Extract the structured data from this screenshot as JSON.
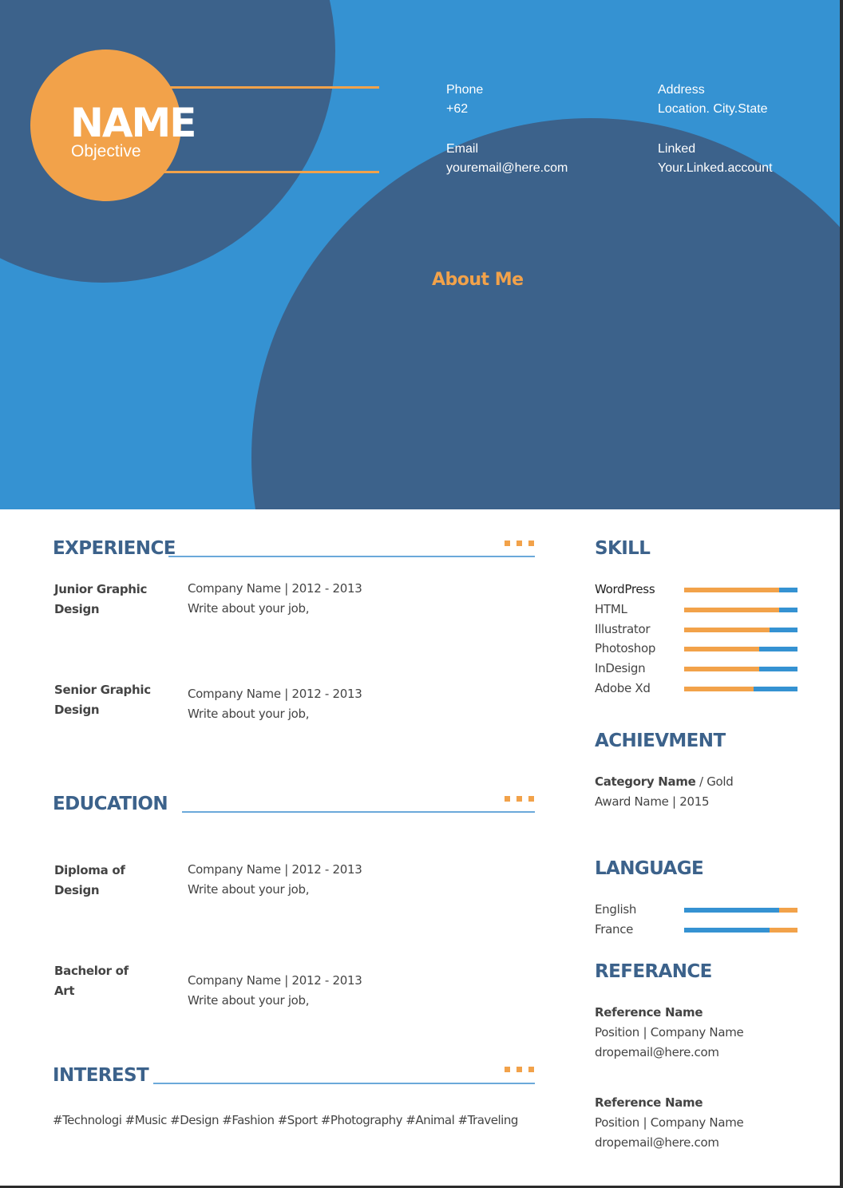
{
  "header": {
    "name": "NAME",
    "objective": "Objective",
    "contacts": [
      {
        "label": "Phone",
        "value": "+62"
      },
      {
        "label": "Address",
        "value": "Location. City.State"
      },
      {
        "label": "Email",
        "value": "youremail@here.com"
      },
      {
        "label": "Linked",
        "value": "Your.Linked.account"
      }
    ],
    "about_title": "About Me"
  },
  "colors": {
    "light_blue": "#3592d2",
    "dark_blue": "#3c628b",
    "orange": "#f2a24a",
    "text": "#444444"
  },
  "experience": {
    "title": "EXPERIENCE",
    "entries": [
      {
        "title": "Junior Graphic Design",
        "company": "Company Name | 2012 - 2013",
        "desc": "Write about your job,"
      },
      {
        "title": "Senior Graphic Design",
        "company": "Company Name | 2012 - 2013",
        "desc": "Write about your job,"
      }
    ]
  },
  "education": {
    "title": "EDUCATION",
    "entries": [
      {
        "title": "Diploma of Design",
        "company": "Company Name | 2012 - 2013",
        "desc": "Write about your job,"
      },
      {
        "title": "Bachelor of Art",
        "company": "Company Name | 2012 - 2013",
        "desc": "Write about your job,"
      }
    ]
  },
  "interest": {
    "title": "INTEREST",
    "text": "#Technologi #Music #Design #Fashion #Sport #Photography #Animal #Traveling"
  },
  "skill": {
    "title": "SKILL",
    "items": [
      {
        "label": "WordPress",
        "level": 0.84
      },
      {
        "label": "HTML",
        "level": 0.84
      },
      {
        "label": "Illustrator",
        "level": 0.75
      },
      {
        "label": "Photoshop",
        "level": 0.66
      },
      {
        "label": "InDesign",
        "level": 0.66
      },
      {
        "label": "Adobe Xd",
        "level": 0.61
      }
    ]
  },
  "achievement": {
    "title": "ACHIEVMENT",
    "category": "Category Name",
    "medal": " / Gold",
    "award": "Award Name | 2015"
  },
  "language": {
    "title": "LANGUAGE",
    "items": [
      {
        "label": "English",
        "level": 0.84
      },
      {
        "label": "France",
        "level": 0.75
      }
    ]
  },
  "reference": {
    "title": "REFERANCE",
    "items": [
      {
        "name": "Reference Name",
        "position": "Position | Company Name",
        "email": "dropemail@here.com"
      },
      {
        "name": "Reference Name",
        "position": "Position | Company Name",
        "email": "dropemail@here.com"
      }
    ]
  }
}
